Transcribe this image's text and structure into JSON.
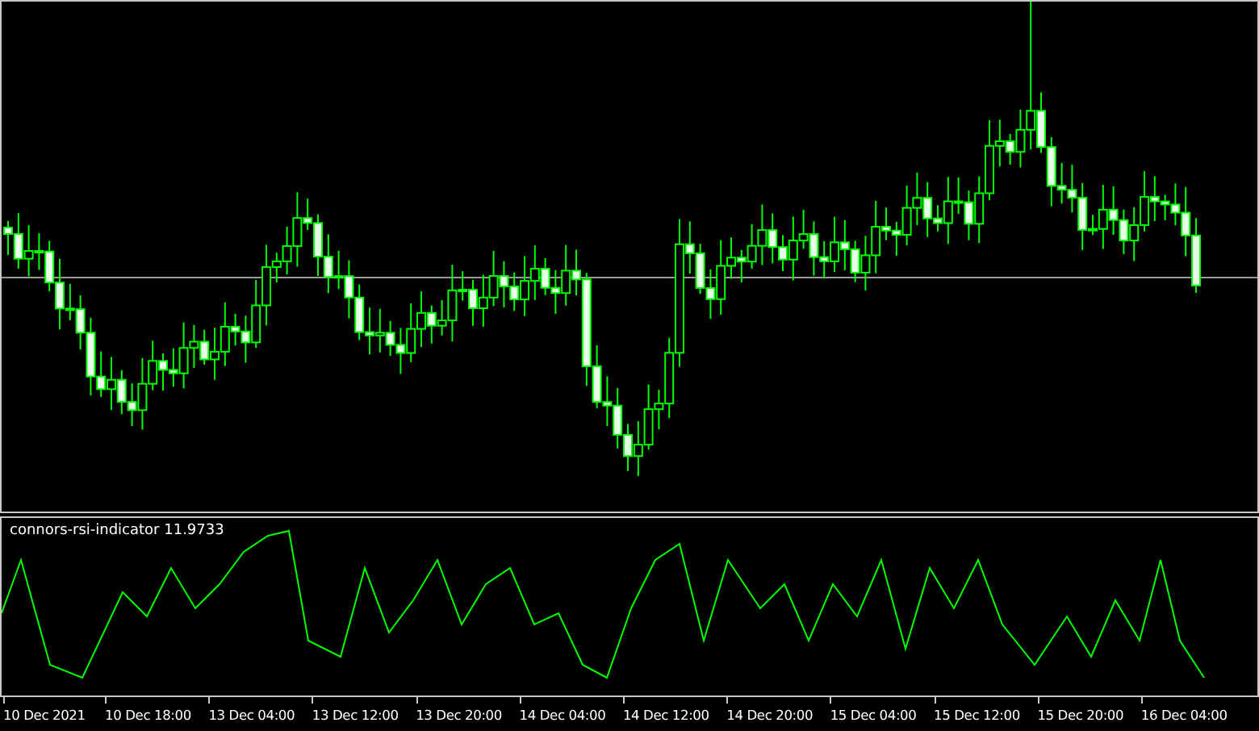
{
  "indicator": {
    "label": "connors-rsi-indicator 11.9733"
  },
  "time_axis": {
    "labels": [
      "10 Dec 2021",
      "10 Dec 18:00",
      "13 Dec 04:00",
      "13 Dec 12:00",
      "13 Dec 20:00",
      "14 Dec 04:00",
      "14 Dec 12:00",
      "14 Dec 20:00",
      "15 Dec 04:00",
      "15 Dec 12:00",
      "15 Dec 20:00",
      "16 Dec 04:00"
    ]
  }
}
